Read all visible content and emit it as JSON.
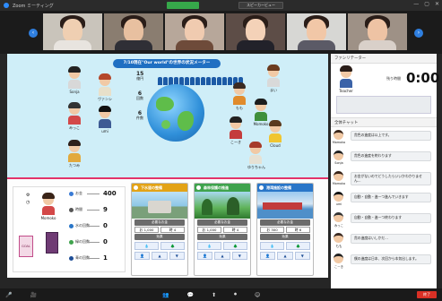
{
  "titlebar": {
    "app_name": "Zoom ミーティング",
    "view_button": "スピーカービュー"
  },
  "window_controls": {
    "minimize": "—",
    "maximize": "▢",
    "close": "✕"
  },
  "nav": {
    "prev_icon": "‹",
    "next_icon": "›"
  },
  "world_panel": {
    "title": "7/10現在\"Our world\"の世界の状況メーター",
    "stats": [
      {
        "big": "15",
        "small": "億円"
      },
      {
        "big": "6",
        "small": "回数"
      },
      {
        "big": "6",
        "small": "件数"
      }
    ],
    "players": [
      "Sonja",
      "ヴァンシ",
      "みっこ",
      "umi",
      "たつみ",
      "もも",
      "まい",
      "Momoko",
      "こーき",
      "Cloud",
      "ゆりちゃん"
    ]
  },
  "player_sheet": {
    "resources": [
      {
        "label": "お金",
        "value": "400"
      },
      {
        "label": "時間",
        "value": "9"
      },
      {
        "label": "水の回数",
        "value": "0"
      },
      {
        "label": "緑の回数",
        "value": "0"
      },
      {
        "label": "青の回数",
        "value": "1"
      }
    ],
    "player_label": "Momoko",
    "portrait_label": "GOAL"
  },
  "cards": [
    {
      "title": "下水道の整備",
      "color": "#e3a317",
      "cost": "1,000",
      "time": "4"
    },
    {
      "title": "森林保護の推進",
      "color": "#3fa34d",
      "cost": "1,000",
      "time": "4"
    },
    {
      "title": "港湾施設の整備",
      "color": "#2a76c8",
      "cost": "300",
      "time": "6"
    }
  ],
  "card_labels": {
    "money": "必要なお金",
    "time": "必要な時間",
    "effect": "効果",
    "money_icon": "お",
    "time_icon": "時"
  },
  "facilitator": {
    "header": "ファシリテーター",
    "name": "Teacher",
    "time_label": "残り時間",
    "time_value": "0:00"
  },
  "chat": {
    "header": "全体チャット",
    "messages": [
      {
        "who": "Momoko",
        "text": "貴色の進度は以上です。"
      },
      {
        "who": "Sonja",
        "text": "貴色の進度を終わります"
      },
      {
        "who": "Momoko",
        "text": "お金がないのでどうしたらいいかわかりません…"
      },
      {
        "who": "umi",
        "text": "自動・自動・進一つ進んでいきます"
      },
      {
        "who": "みっこ",
        "text": "自動・自動・進一つ終わります"
      },
      {
        "who": "もも",
        "text": "貴の進度はいしかだ…"
      },
      {
        "who": "こーき",
        "text": "僕の進度は日本、次回から本気出します。"
      }
    ]
  },
  "toolbar": {
    "items": [
      "🎤",
      "🎥",
      "👥",
      "💬",
      "⬆",
      "⏺",
      "☺"
    ],
    "end_label": "終了"
  }
}
